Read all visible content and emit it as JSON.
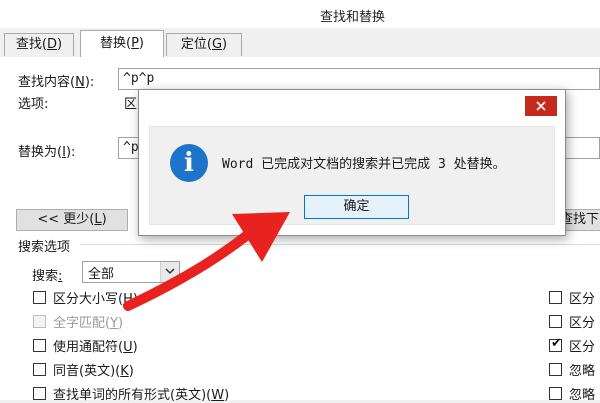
{
  "window": {
    "title": "查找和替换"
  },
  "tabs": [
    {
      "label": "查找",
      "hotkey": "D",
      "active": false
    },
    {
      "label": "替换",
      "hotkey": "P",
      "active": true
    },
    {
      "label": "定位",
      "hotkey": "G",
      "active": false
    }
  ],
  "find": {
    "label": "查找内容",
    "hotkey": "N",
    "value": "^p^p"
  },
  "options": {
    "label": "选项:",
    "value_partial": "区"
  },
  "replace": {
    "label": "替换为",
    "hotkey": "I",
    "value_partial": "^p"
  },
  "buttons": {
    "less": {
      "prefix": "<< ",
      "label": "更少",
      "hotkey": "L"
    },
    "find_next_partial": "查找下"
  },
  "search_options": {
    "header": "搜索选项",
    "search_label": "搜索",
    "search_hotkey": ":",
    "search_value": "全部"
  },
  "checkboxes_left": [
    {
      "label": "区分大小写",
      "hotkey": "H",
      "checked": false,
      "disabled": false
    },
    {
      "label": "全字匹配",
      "hotkey": "Y",
      "checked": false,
      "disabled": true
    },
    {
      "label": "使用通配符",
      "hotkey": "U",
      "checked": false,
      "disabled": false
    },
    {
      "label": "同音(英文)",
      "hotkey": "K",
      "checked": false,
      "disabled": false
    },
    {
      "label": "查找单词的所有形式(英文)",
      "hotkey": "W",
      "checked": false,
      "disabled": false
    }
  ],
  "checkboxes_right": [
    {
      "label": "区分",
      "checked": false
    },
    {
      "label": "区分",
      "checked": false
    },
    {
      "label": "区分",
      "checked": true
    },
    {
      "label": "忽略",
      "checked": false
    },
    {
      "label": "忽略",
      "checked": false
    }
  ],
  "dialog": {
    "message": "Word 已完成对文档的搜索并已完成 3 处替换。",
    "ok_label": "确定",
    "icon": "info-icon",
    "close_color": "#c42b1c",
    "info_color": "#1e74c8"
  },
  "annotation": {
    "arrow_color": "#e8231f"
  }
}
